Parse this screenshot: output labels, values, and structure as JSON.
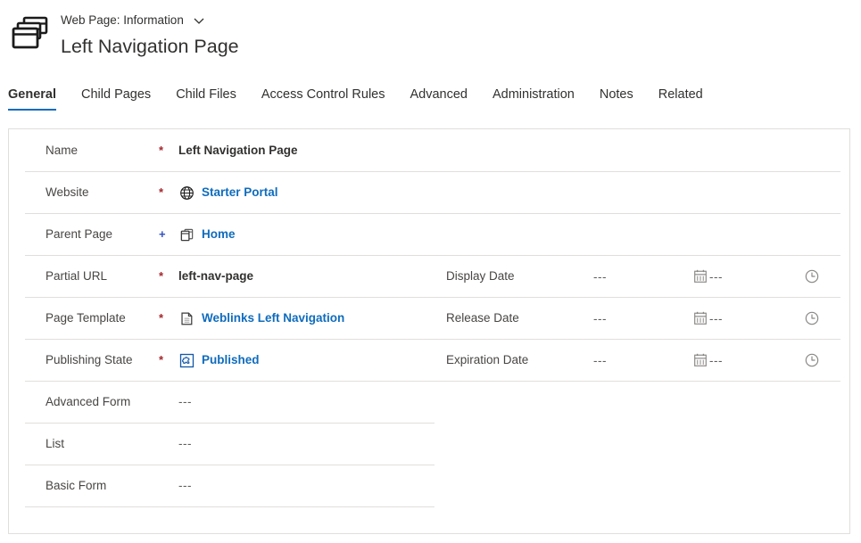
{
  "header": {
    "record_icon": "web-page-icon",
    "breadcrumb": "Web Page: Information",
    "chevron_icon": "chevron-down-icon",
    "title": "Left Navigation Page"
  },
  "tabs": [
    {
      "label": "General",
      "active": true
    },
    {
      "label": "Child Pages",
      "active": false
    },
    {
      "label": "Child Files",
      "active": false
    },
    {
      "label": "Access Control Rules",
      "active": false
    },
    {
      "label": "Advanced",
      "active": false
    },
    {
      "label": "Administration",
      "active": false
    },
    {
      "label": "Notes",
      "active": false
    },
    {
      "label": "Related",
      "active": false
    }
  ],
  "form": {
    "left_fields": [
      {
        "label": "Name",
        "marker": "*",
        "marker_type": "required",
        "value": "Left Navigation Page",
        "value_style": "bold",
        "icon": null
      },
      {
        "label": "Website",
        "marker": "*",
        "marker_type": "required",
        "value": "Starter Portal",
        "value_style": "link",
        "icon": "globe-icon"
      },
      {
        "label": "Parent Page",
        "marker": "+",
        "marker_type": "lookup",
        "value": "Home",
        "value_style": "link",
        "icon": "web-page-small-icon"
      },
      {
        "label": "Partial URL",
        "marker": "*",
        "marker_type": "required",
        "value": "left-nav-page",
        "value_style": "bold",
        "icon": null
      },
      {
        "label": "Page Template",
        "marker": "*",
        "marker_type": "required",
        "value": "Weblinks Left Navigation",
        "value_style": "link",
        "icon": "document-icon"
      },
      {
        "label": "Publishing State",
        "marker": "*",
        "marker_type": "required",
        "value": "Published",
        "value_style": "link",
        "icon": "publishing-state-icon"
      },
      {
        "label": "Advanced Form",
        "marker": "",
        "marker_type": "none",
        "value": "---",
        "value_style": "empty",
        "icon": null
      },
      {
        "label": "List",
        "marker": "",
        "marker_type": "none",
        "value": "---",
        "value_style": "empty",
        "icon": null
      },
      {
        "label": "Basic Form",
        "marker": "",
        "marker_type": "none",
        "value": "---",
        "value_style": "empty",
        "icon": null
      }
    ],
    "right_fields": [
      {
        "label": "Display Date",
        "date_value": "---",
        "calendar_icon": "calendar-icon",
        "time_value": "---",
        "clock_icon": "clock-icon"
      },
      {
        "label": "Release Date",
        "date_value": "---",
        "calendar_icon": "calendar-icon",
        "time_value": "---",
        "clock_icon": "clock-icon"
      },
      {
        "label": "Expiration Date",
        "date_value": "---",
        "calendar_icon": "calendar-icon",
        "time_value": "---",
        "clock_icon": "clock-icon"
      }
    ]
  },
  "colors": {
    "accent": "#0f6cbd",
    "link": "#0f6cbd",
    "required": "#a4262c",
    "lookup_plus": "#2f50c1",
    "text": "#323130",
    "label": "#484644",
    "muted": "#605e5c",
    "border": "#e1dfdd",
    "background": "#ffffff"
  }
}
